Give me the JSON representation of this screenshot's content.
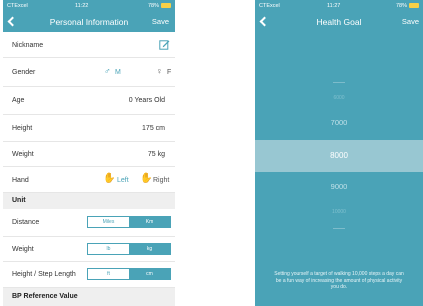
{
  "left_screen": {
    "status": {
      "carrier": "CTExcel",
      "time": "11:22",
      "battery": "78%"
    },
    "title": "Personal Information",
    "save_label": "Save",
    "nickname_label": "Nickname",
    "gender": {
      "label": "Gender",
      "male": "M",
      "female": "F"
    },
    "age": {
      "label": "Age",
      "value": "0  Years Old"
    },
    "height": {
      "label": "Height",
      "value": "175  cm"
    },
    "weight": {
      "label": "Weight",
      "value": "75  kg"
    },
    "hand": {
      "label": "Hand",
      "left": "Left",
      "right": "Right"
    },
    "unit_section": "Unit",
    "distance": {
      "label": "Distance",
      "options": [
        "Miles",
        "Km"
      ],
      "selected": "Km"
    },
    "weight_unit": {
      "label": "Weight",
      "options": [
        "lb",
        "kg"
      ],
      "selected": "kg"
    },
    "step_length": {
      "label": "Height / Step Length",
      "options": [
        "ft",
        "cm"
      ],
      "selected": "cm"
    },
    "bp_section": "BP Reference Value"
  },
  "right_screen": {
    "status": {
      "carrier": "CTExcel",
      "time": "11:27",
      "battery": "78%"
    },
    "title": "Health Goal",
    "save_label": "Save",
    "picker": {
      "above2": "6000",
      "above1": "7000",
      "selected": "8000",
      "below1": "9000",
      "below2": "10000"
    },
    "note": "Setting yourself a target of walking 10,000 steps a day can be a fun way of increasing the amount of physical activity you do."
  },
  "colors": {
    "accent": "#4aa3b7",
    "accent_light": "#98c7d2",
    "hand_icon": "#4aa3b7"
  }
}
